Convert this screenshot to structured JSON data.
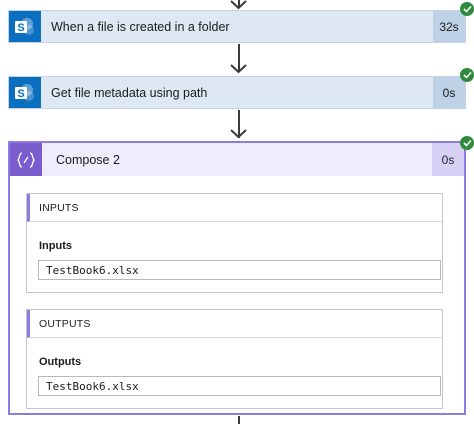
{
  "steps": [
    {
      "title": "When a file is created in a folder",
      "duration": "32s",
      "icon": "sharepoint-icon"
    },
    {
      "title": "Get file metadata using path",
      "duration": "0s",
      "icon": "sharepoint-icon"
    }
  ],
  "compose": {
    "title": "Compose 2",
    "duration": "0s",
    "icon": "compose-braces-icon",
    "inputs": {
      "header": "INPUTS",
      "label": "Inputs",
      "value": "TestBook6.xlsx"
    },
    "outputs": {
      "header": "OUTPUTS",
      "label": "Outputs",
      "value": "TestBook6.xlsx"
    }
  },
  "colors": {
    "sharepoint": "#0a6fbf",
    "compose": "#7a5ccc",
    "success": "#2e8b3e"
  }
}
